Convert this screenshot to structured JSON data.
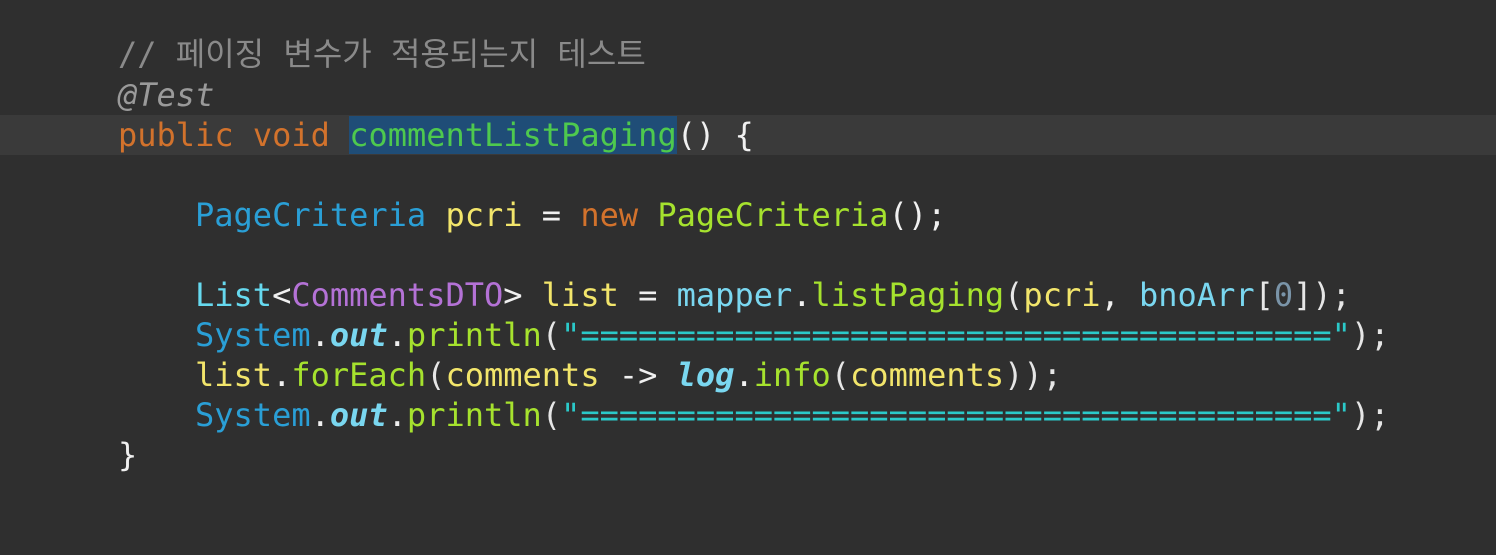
{
  "editor": {
    "lines": {
      "l1": {
        "comment": "// 페이징 변수가 적용되는지 테스트"
      },
      "l2": {
        "annotation": "@Test"
      },
      "l3": {
        "kw_public": "public",
        "kw_void": "void",
        "method_name": "commentListPaging",
        "rest": "() {"
      },
      "l5": {
        "type": "PageCriteria",
        "var": "pcri",
        "eq": " = ",
        "kw_new": "new",
        "ctor": "PageCriteria",
        "end": "();"
      },
      "l7": {
        "type": "List",
        "lt": "<",
        "generic": "CommentsDTO",
        "gt": ">",
        "var": "list",
        "eq": " = ",
        "obj": "mapper",
        "dot": ".",
        "call": "listPaging",
        "open": "(",
        "arg1": "pcri",
        "comma": ", ",
        "arg2": "bnoArr",
        "lbr": "[",
        "index": "0",
        "rbr": "]",
        "close": ");"
      },
      "l8": {
        "cls": "System",
        "dot1": ".",
        "field": "out",
        "dot2": ".",
        "call": "println",
        "open": "(",
        "str": "\"=======================================\"",
        "close": ");"
      },
      "l9": {
        "obj": "list",
        "dot1": ".",
        "call": "forEach",
        "open": "(",
        "param": "comments",
        "arrow": " -> ",
        "logger": "log",
        "dot2": ".",
        "call2": "info",
        "open2": "(",
        "arg": "comments",
        "close": "));"
      },
      "l10": {
        "cls": "System",
        "dot1": ".",
        "field": "out",
        "dot2": ".",
        "call": "println",
        "open": "(",
        "str": "\"=======================================\"",
        "close": ");"
      },
      "l11": {
        "brace": "}"
      }
    }
  }
}
